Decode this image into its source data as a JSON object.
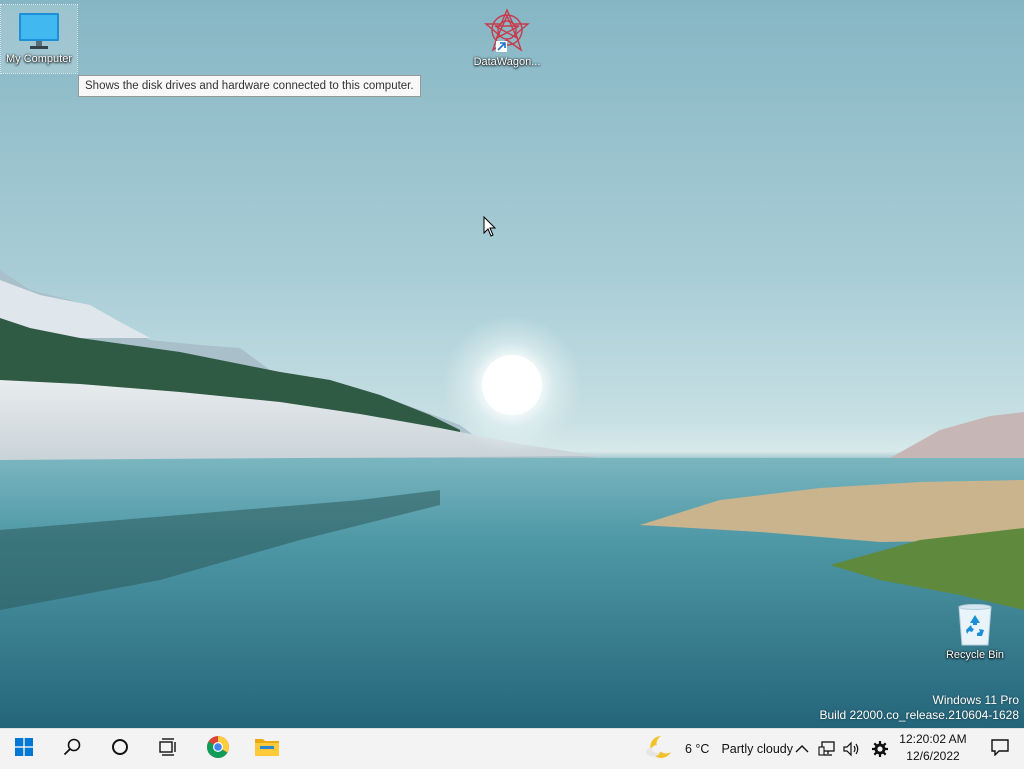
{
  "desktop": {
    "icons": [
      {
        "label": "My Computer",
        "icon": "monitor-icon"
      },
      {
        "label": "DataWagon...",
        "icon": "datawagon-app-icon"
      },
      {
        "label": "Recycle Bin",
        "icon": "recycle-bin-icon"
      }
    ],
    "tooltip": "Shows the disk drives and hardware connected to this computer.",
    "watermark": {
      "line1": "Windows 11 Pro",
      "line2": "Build 22000.co_release.210604-1628"
    }
  },
  "taskbar": {
    "buttons": [
      {
        "name": "start-button",
        "icon": "windows-logo-icon"
      },
      {
        "name": "search-button",
        "icon": "search-icon"
      },
      {
        "name": "cortana-button",
        "icon": "circle-icon"
      },
      {
        "name": "task-view-button",
        "icon": "task-view-icon"
      },
      {
        "name": "chrome-button",
        "icon": "chrome-icon"
      },
      {
        "name": "file-explorer-button",
        "icon": "folder-icon"
      }
    ],
    "weather": {
      "temp": "6 °C",
      "condition": "Partly cloudy",
      "icon": "moon-cloud-icon"
    },
    "tray_icons": [
      "chevron-up-icon",
      "network-icon",
      "volume-icon",
      "gear-icon"
    ],
    "clock": {
      "time": "12:20:02 AM",
      "date": "12/6/2022"
    },
    "notification_icon": "notification-icon"
  },
  "colors": {
    "taskbar_bg": "#f3f3f3",
    "accent_blue": "#0078d4",
    "tooltip_bg": "#f8f8f8"
  }
}
